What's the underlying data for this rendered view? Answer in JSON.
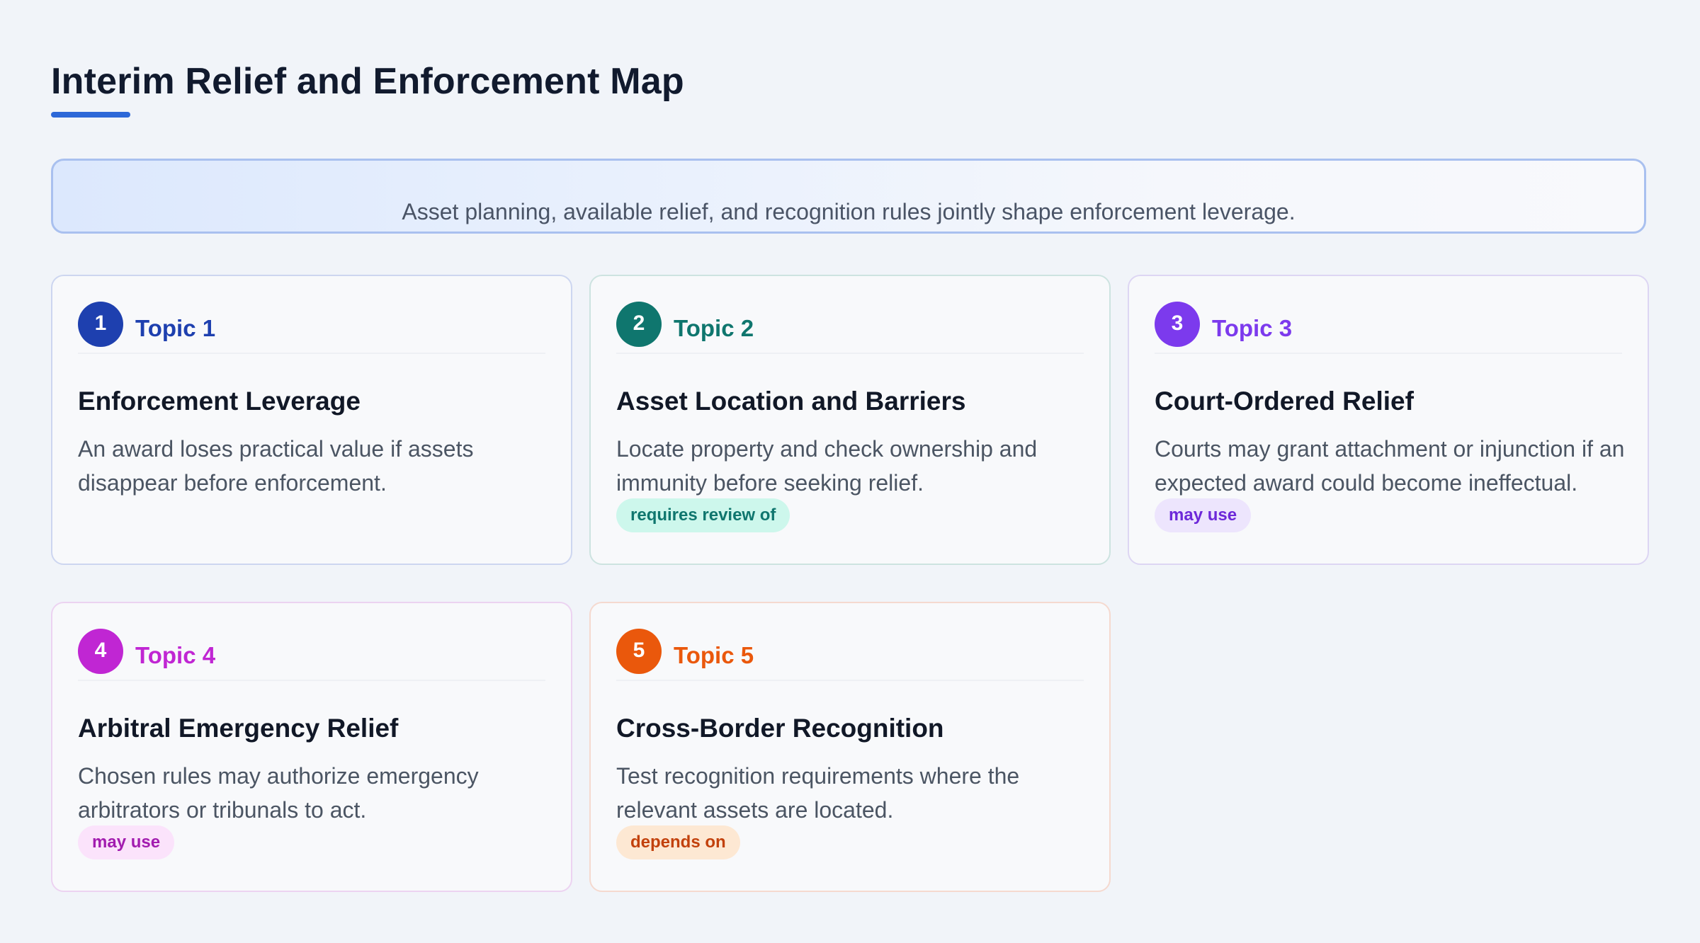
{
  "header": {
    "title": "Interim Relief and Enforcement Map"
  },
  "summary": {
    "text": "Asset planning, available relief, and recognition rules jointly shape enforcement leverage."
  },
  "colors": {
    "underline": "#2d68d8",
    "topic1": "#1e40af",
    "topic2": "#0f766e",
    "topic3": "#7c3aed",
    "topic4": "#c026d3",
    "topic5": "#ea580c"
  },
  "cards": [
    {
      "number": "1",
      "topic": "Topic 1",
      "title": "Enforcement Leverage",
      "description": "An award loses practical value if assets disappear before enforcement.",
      "tag": ""
    },
    {
      "number": "2",
      "topic": "Topic 2",
      "title": "Asset Location and Barriers",
      "description": "Locate property and check ownership and immunity before seeking relief.",
      "tag": "requires review of"
    },
    {
      "number": "3",
      "topic": "Topic 3",
      "title": "Court-Ordered Relief",
      "description": "Courts may grant attachment or injunction if an expected award could become ineffectual.",
      "tag": "may use"
    },
    {
      "number": "4",
      "topic": "Topic 4",
      "title": "Arbitral Emergency Relief",
      "description": "Chosen rules may authorize emergency arbitrators or tribunals to act.",
      "tag": "may use"
    },
    {
      "number": "5",
      "topic": "Topic 5",
      "title": "Cross-Border Recognition",
      "description": "Test recognition requirements where the relevant assets are located.",
      "tag": "depends on"
    }
  ]
}
